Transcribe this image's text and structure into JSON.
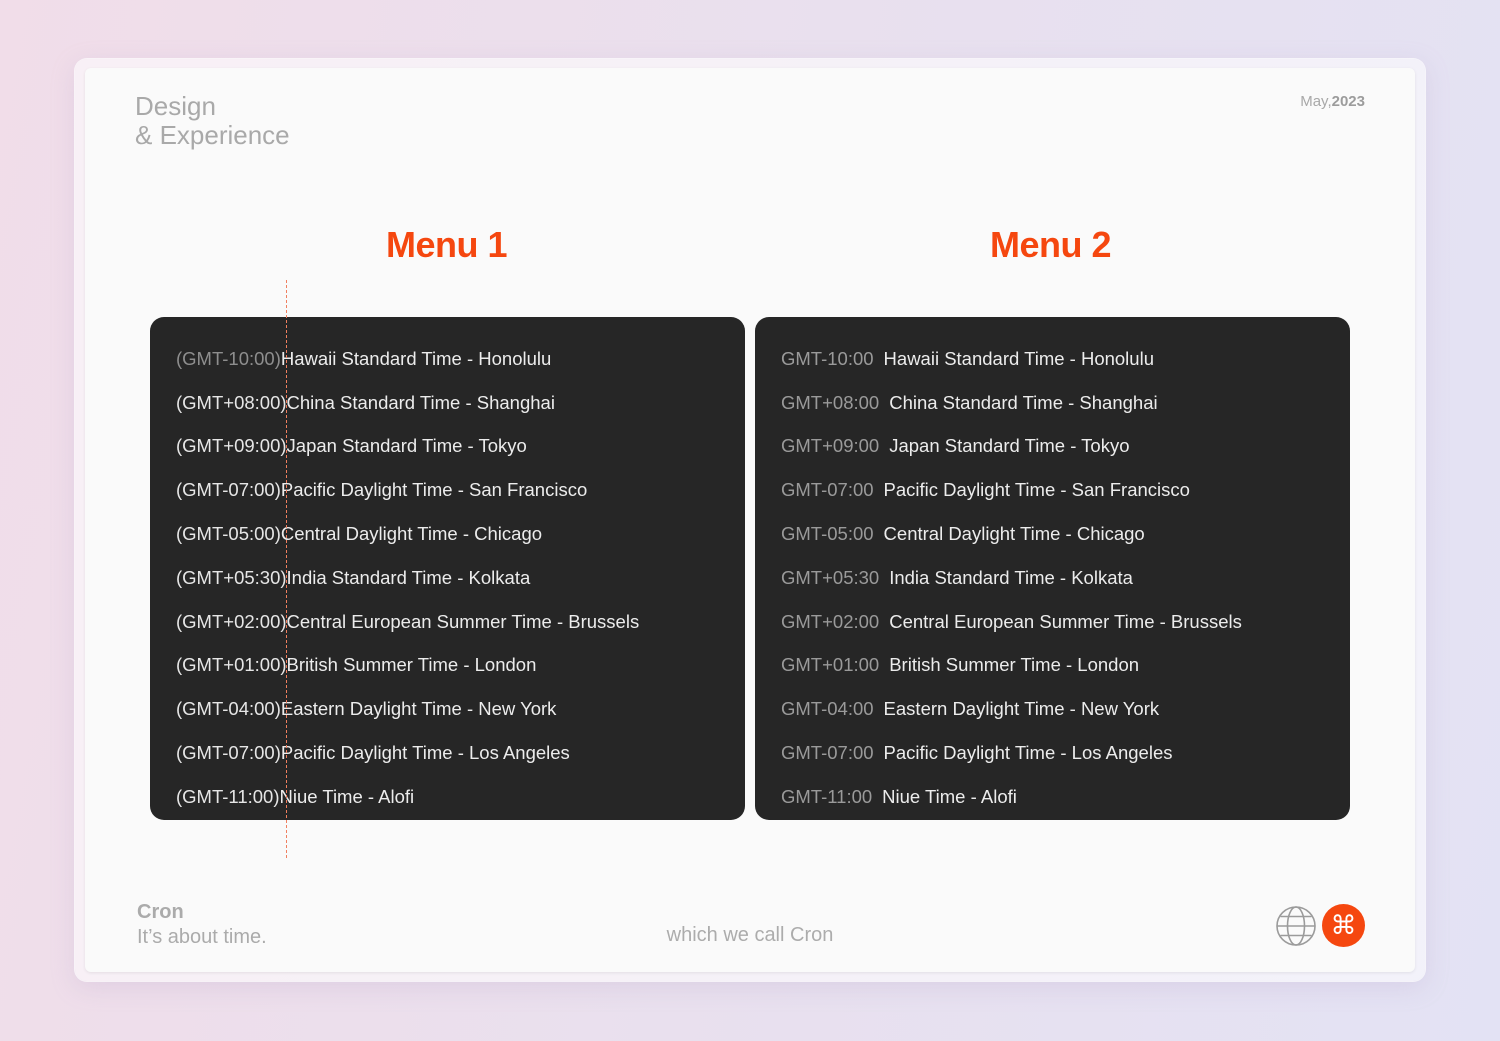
{
  "header": {
    "brand_line1": "Design",
    "brand_line2": "& Experience",
    "date_month": "May,",
    "date_year": "2023"
  },
  "menu1": {
    "title": "Menu 1",
    "items": [
      {
        "offset": "(GMT-10:00)",
        "label": "Hawaii Standard Time - Honolulu"
      },
      {
        "offset": "(GMT+08:00)",
        "label": "China Standard Time - Shanghai"
      },
      {
        "offset": "(GMT+09:00)",
        "label": "Japan Standard Time - Tokyo"
      },
      {
        "offset": "(GMT-07:00)",
        "label": "Pacific Daylight Time - San Francisco"
      },
      {
        "offset": "(GMT-05:00)",
        "label": "Central Daylight Time - Chicago"
      },
      {
        "offset": "(GMT+05:30)",
        "label": "India Standard Time - Kolkata"
      },
      {
        "offset": "(GMT+02:00)",
        "label": "Central European Summer Time - Brussels"
      },
      {
        "offset": "(GMT+01:00)",
        "label": "British Summer Time - London"
      },
      {
        "offset": "(GMT-04:00)",
        "label": "Eastern Daylight Time - New York"
      },
      {
        "offset": "(GMT-07:00)",
        "label": "Pacific Daylight Time - Los Angeles"
      },
      {
        "offset": "(GMT-11:00)",
        "label": "Niue Time - Alofi"
      }
    ]
  },
  "menu2": {
    "title": "Menu 2",
    "items": [
      {
        "offset": "GMT-10:00",
        "label": "Hawaii Standard Time - Honolulu"
      },
      {
        "offset": "GMT+08:00",
        "label": "China Standard Time - Shanghai"
      },
      {
        "offset": "GMT+09:00",
        "label": "Japan Standard Time - Tokyo"
      },
      {
        "offset": "GMT-07:00",
        "label": "Pacific Daylight Time - San Francisco"
      },
      {
        "offset": "GMT-05:00",
        "label": "Central Daylight Time - Chicago"
      },
      {
        "offset": "GMT+05:30",
        "label": "India Standard Time - Kolkata"
      },
      {
        "offset": "GMT+02:00",
        "label": "Central European Summer Time - Brussels"
      },
      {
        "offset": "GMT+01:00",
        "label": "British Summer Time - London"
      },
      {
        "offset": "GMT-04:00",
        "label": "Eastern Daylight Time - New York"
      },
      {
        "offset": "GMT-07:00",
        "label": "Pacific Daylight Time - Los Angeles"
      },
      {
        "offset": "GMT-11:00",
        "label": "Niue Time - Alofi"
      }
    ]
  },
  "footer": {
    "brand_name": "Cron",
    "tagline": "It’s about time.",
    "center_text": "which we call Cron",
    "globe_icon": "globe-icon",
    "command_icon": "command-icon",
    "command_glyph": "⌘"
  },
  "colors": {
    "accent": "#f5470f",
    "panel": "#262626",
    "background": "#fafafa"
  }
}
